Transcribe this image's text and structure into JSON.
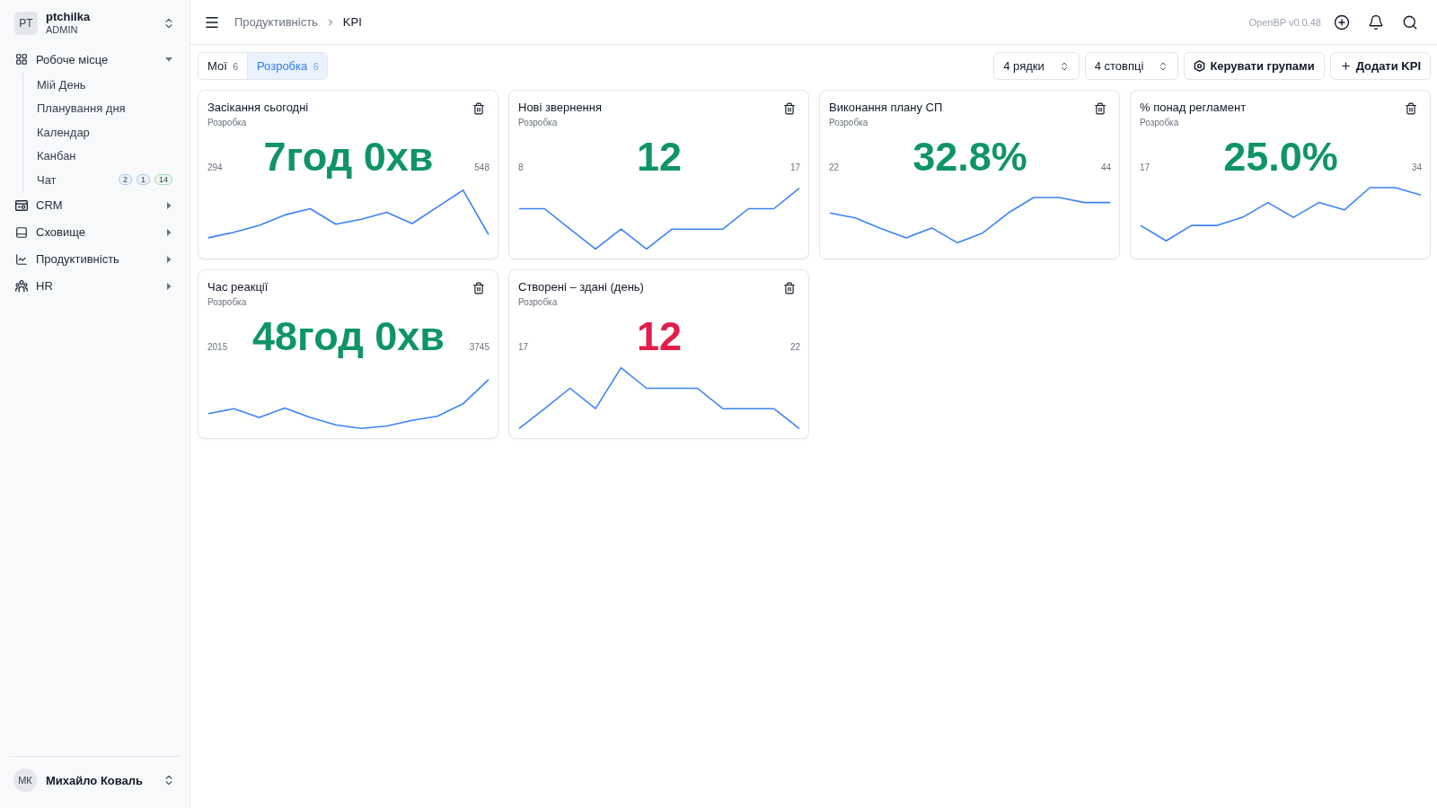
{
  "sidebar": {
    "workspace": {
      "initials": "PT",
      "name": "ptchilka",
      "role": "ADMIN"
    },
    "items": [
      {
        "label": "Робоче місце",
        "expanded": true,
        "selected": false,
        "children": [
          {
            "label": "Мій День",
            "selected": false
          },
          {
            "label": "Планування дня",
            "selected": false
          },
          {
            "label": "Календар",
            "selected": false
          },
          {
            "label": "Канбан",
            "selected": false
          },
          {
            "label": "Чат",
            "selected": false,
            "badges": [
              {
                "text": "2",
                "color": "#a9c9f2"
              },
              {
                "text": "1",
                "color": "#a9c9f2"
              },
              {
                "text": "14",
                "color": "#a3dcbc"
              }
            ]
          }
        ]
      },
      {
        "label": "CRM",
        "expanded": false,
        "selected": false
      },
      {
        "label": "Сховище",
        "expanded": false,
        "selected": false
      },
      {
        "label": "Продуктивність",
        "expanded": false,
        "selected": false
      },
      {
        "label": "HR",
        "expanded": false,
        "selected": false
      }
    ],
    "user": {
      "initials": "МК",
      "name": "Михайло Коваль"
    }
  },
  "topbar": {
    "breadcrumb": [
      "Продуктивність",
      "KPI"
    ],
    "version": "OpenBP v0.0.48"
  },
  "toolbar": {
    "tabs": [
      {
        "label": "Мої",
        "count": "6",
        "selected": false
      },
      {
        "label": "Розробка",
        "count": "6",
        "selected": true
      }
    ],
    "selects": [
      "4 рядки",
      "4 стовпці"
    ],
    "buttons": [
      "Керувати групами",
      "Додати KPI"
    ]
  },
  "cards": [
    {
      "title": "Засікання сьогодні",
      "group": "Розробка",
      "value": "7год 0хв",
      "color": "#0f9565",
      "min": "294",
      "max": "548"
    },
    {
      "title": "Нові звернення",
      "group": "Розробка",
      "value": "12",
      "color": "#0f9565",
      "min": "8",
      "max": "17"
    },
    {
      "title": "Виконання плану СП",
      "group": "Розробка",
      "value": "32.8%",
      "color": "#0f9565",
      "min": "22",
      "max": "44"
    },
    {
      "title": "% понад регламент",
      "group": "Розробка",
      "value": "25.0%",
      "color": "#0f9565",
      "min": "17",
      "max": "34"
    },
    {
      "title": "Час реакції",
      "group": "Розробка",
      "value": "48год 0хв",
      "color": "#0f9565",
      "min": "2015",
      "max": "3745"
    },
    {
      "title": "Створені – здані (день)",
      "group": "Розробка",
      "value": "12",
      "color": "#e11d48",
      "min": "17",
      "max": "22"
    }
  ]
}
